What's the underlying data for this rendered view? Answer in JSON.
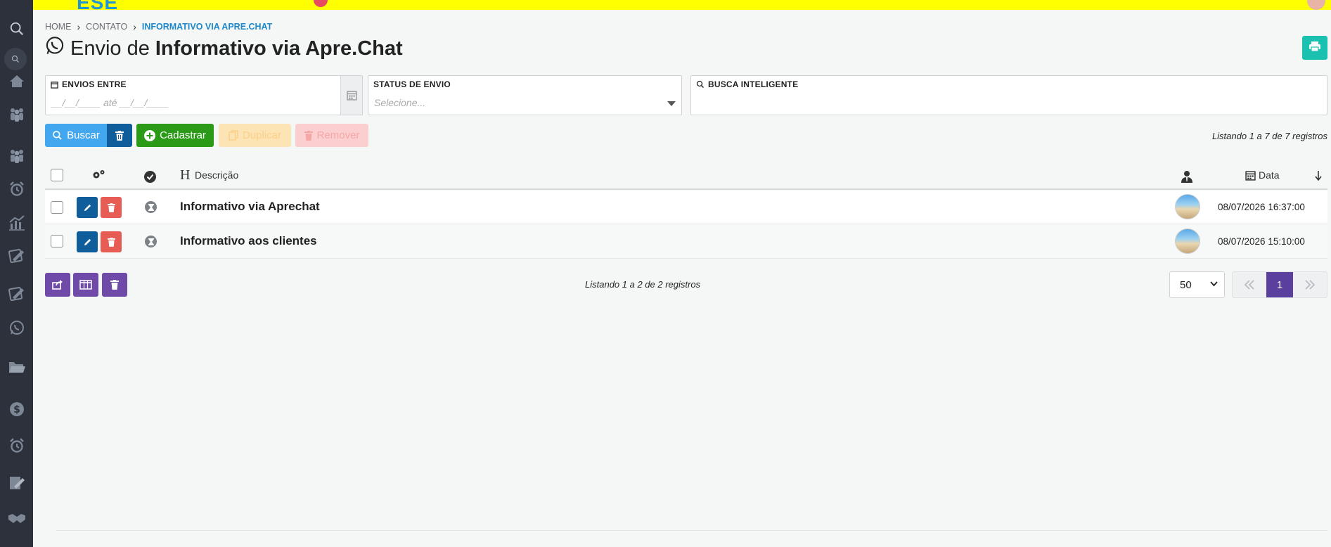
{
  "brand": {
    "text": "ESE"
  },
  "breadcrumb": {
    "items": [
      "HOME",
      "CONTATO"
    ],
    "current": "INFORMATIVO VIA APRE.CHAT"
  },
  "page": {
    "title_prefix": "Envio de",
    "title_bold": "Informativo via Apre.Chat"
  },
  "filters": {
    "dates_label": "ENVIOS ENTRE",
    "dates_placeholder": "__/__/____ até __/__/____",
    "status_label": "STATUS DE ENVIO",
    "status_placeholder": "Selecione...",
    "busca_label": "BUSCA INTELIGENTE",
    "busca_value": ""
  },
  "toolbar": {
    "buscar": "Buscar",
    "cadastrar": "Cadastrar",
    "duplicar": "Duplicar",
    "remover": "Remover",
    "listing_top": "Listando 1 a 7 de 7 registros"
  },
  "table": {
    "col_descricao": "Descrição",
    "col_data": "Data",
    "rows": [
      {
        "descricao": "Informativo via Aprechat",
        "data": "08/07/2026 16:37:00"
      },
      {
        "descricao": "Informativo aos clientes",
        "data": "08/07/2026 15:10:00"
      }
    ]
  },
  "footer": {
    "listing_bottom": "Listando 1 a 2 de 2 registros",
    "per_page": "50",
    "current_page": "1"
  },
  "colors": {
    "sidebar": "#2c313c",
    "topbar": "#ffff00",
    "accent": "#1e88c9",
    "primary_purple": "#6f4aa8"
  }
}
